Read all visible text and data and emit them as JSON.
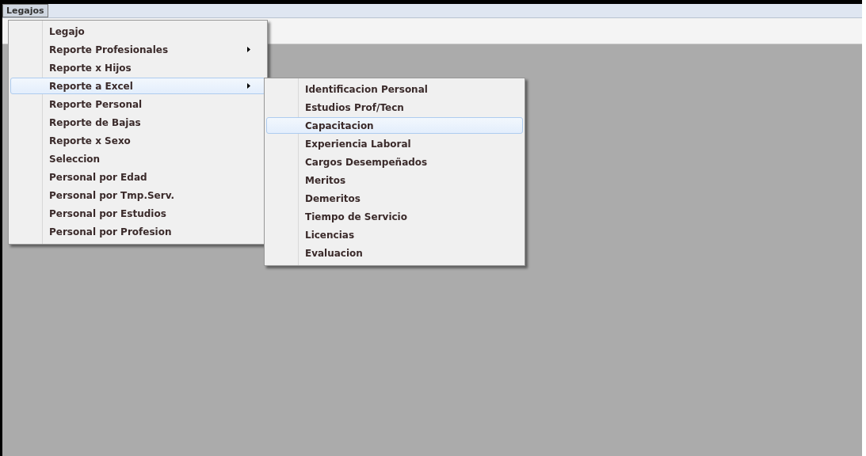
{
  "menu_bar": [
    {
      "label": "Legajos",
      "selected": true
    }
  ],
  "menu": {
    "items": [
      {
        "label": "Legajo",
        "submenu": false,
        "selected": false
      },
      {
        "label": "Reporte Profesionales",
        "submenu": true,
        "selected": false
      },
      {
        "label": "Reporte x Hijos",
        "submenu": false,
        "selected": false
      },
      {
        "label": "Reporte a Excel",
        "submenu": true,
        "selected": true
      },
      {
        "label": "Reporte Personal",
        "submenu": false,
        "selected": false
      },
      {
        "label": "Reporte de Bajas",
        "submenu": false,
        "selected": false
      },
      {
        "label": "Reporte x Sexo",
        "submenu": false,
        "selected": false
      },
      {
        "label": "Seleccion",
        "submenu": false,
        "selected": false
      },
      {
        "label": "Personal por Edad",
        "submenu": false,
        "selected": false
      },
      {
        "label": "Personal por Tmp.Serv.",
        "submenu": false,
        "selected": false
      },
      {
        "label": "Personal por Estudios",
        "submenu": false,
        "selected": false
      },
      {
        "label": "Personal por Profesion",
        "submenu": false,
        "selected": false
      }
    ]
  },
  "submenu": {
    "items": [
      {
        "label": "Identificacion Personal",
        "selected": false
      },
      {
        "label": "Estudios Prof/Tecn",
        "selected": false
      },
      {
        "label": "Capacitacion",
        "selected": true
      },
      {
        "label": "Experiencia Laboral",
        "selected": false
      },
      {
        "label": "Cargos Desempeñados",
        "selected": false
      },
      {
        "label": "Meritos",
        "selected": false
      },
      {
        "label": "Demeritos",
        "selected": false
      },
      {
        "label": "Tiempo de Servicio",
        "selected": false
      },
      {
        "label": "Licencias",
        "selected": false
      },
      {
        "label": "Evaluacion",
        "selected": false
      }
    ]
  }
}
